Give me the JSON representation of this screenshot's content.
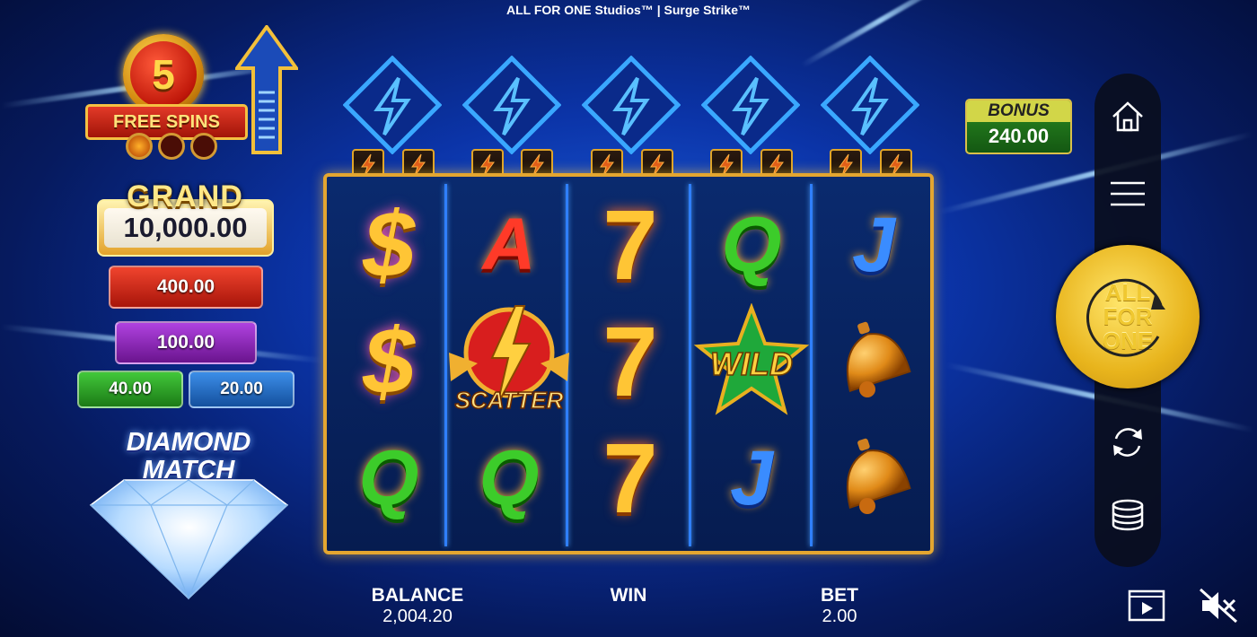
{
  "title": "ALL FOR ONE Studios™ | Surge Strike™",
  "free_spins": {
    "count": "5",
    "label": "FREE SPINS"
  },
  "jackpots": {
    "grand_label": "GRAND",
    "grand_value": "10,000.00",
    "major": "400.00",
    "minor": "100.00",
    "mini_green": "40.00",
    "mini_blue": "20.00"
  },
  "diamond_match": {
    "line1": "DIAMOND",
    "line2": "MATCH"
  },
  "reels": [
    [
      "dollar",
      "dollar",
      "q"
    ],
    [
      "a",
      "scatter",
      "q"
    ],
    [
      "seven",
      "seven",
      "seven"
    ],
    [
      "q",
      "wild",
      "j"
    ],
    [
      "j",
      "bell",
      "bell"
    ]
  ],
  "symbol_text": {
    "dollar": "$",
    "seven": "7",
    "a": "A",
    "q": "Q",
    "j": "J",
    "wild": "WILD",
    "scatter": "SCATTER"
  },
  "bonus": {
    "label": "BONUS",
    "value": "240.00"
  },
  "spin_button": {
    "line1": "ALL",
    "line2": "FOR",
    "line3": "ONE"
  },
  "footer": {
    "balance_label": "BALANCE",
    "balance_value": "2,004.20",
    "win_label": "WIN",
    "win_value": "",
    "bet_label": "BET",
    "bet_value": "2.00"
  },
  "icons": [
    "home-icon",
    "menu-icon",
    "autoplay-icon",
    "bet-stack-icon",
    "video-icon",
    "sound-muted-icon"
  ]
}
